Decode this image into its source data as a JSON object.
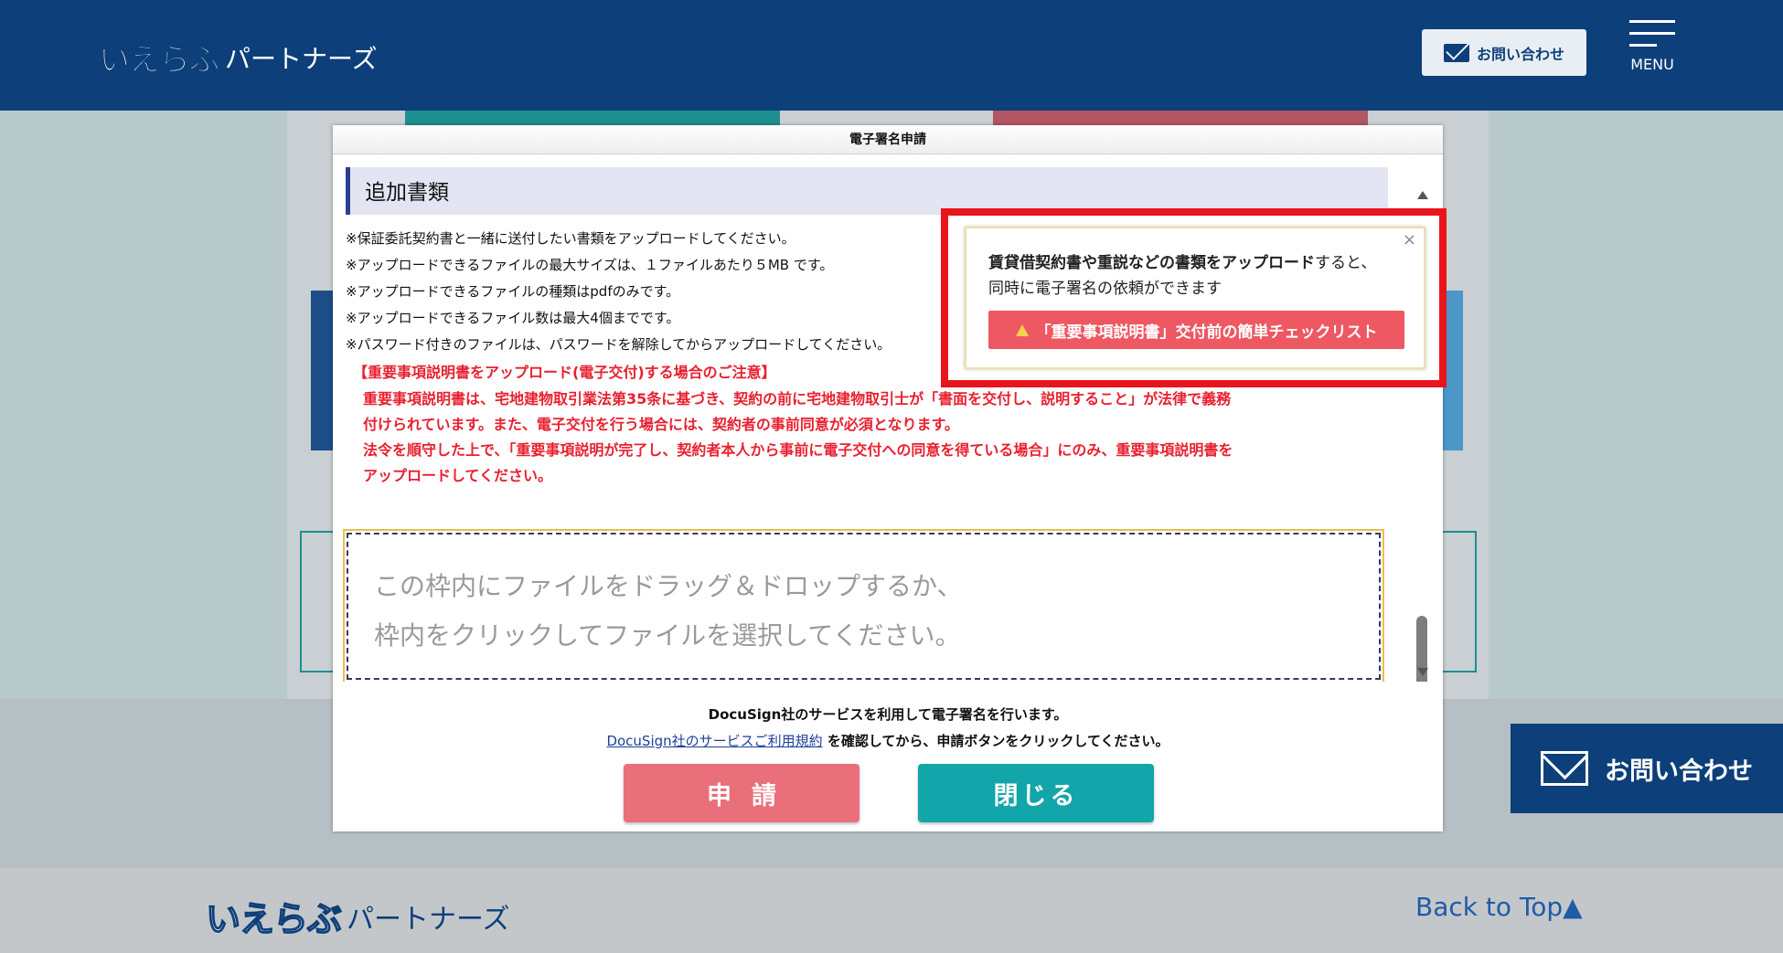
{
  "header": {
    "logo_mark": "いえらぶ",
    "logo_text": "パートナーズ",
    "contact_label": "お問い合わせ",
    "menu_label": "MENU"
  },
  "modal": {
    "title": "電子署名申請",
    "section_title": "追加書類",
    "notes": [
      "※保証委託契約書と一緒に送付したい書類をアップロードしてください。",
      "※アップロードできるファイルの最大サイズは、１ファイルあたり５MB です。",
      "※アップロードできるファイルの種類はpdfのみです。",
      "※アップロードできるファイル数は最大4個までです。",
      "※パスワード付きのファイルは、パスワードを解除してからアップロードしてください。"
    ],
    "warning_title": "【重要事項説明書をアップロード(電子交付)する場合のご注意】",
    "warning_lines": [
      "重要事項説明書は、宅地建物取引業法第35条に基づき、契約の前に宅地建物取引士が「書面を交付し、説明すること」が法律で義務",
      "付けられています。また、電子交付を行う場合には、契約者の事前同意が必須となります。",
      "法令を順守した上で、「重要事項説明が完了し、契約者本人から事前に電子交付への同意を得ている場合」にのみ、重要事項説明書を",
      "アップロードしてください。"
    ],
    "dropzone_line1": "この枠内にファイルをドラッグ＆ドロップするか、",
    "dropzone_line2": "枠内をクリックしてファイルを選択してください。",
    "footer_line1": "DocuSign社のサービスを利用して電子署名を行います。",
    "footer_link": "DocuSign社のサービスご利用規約",
    "footer_line2_rest": " を確認してから、申請ボタンをクリックしてください。",
    "apply_label": "申請",
    "close_label": "閉じる"
  },
  "tooltip": {
    "bold_text": "賃貸借契約書や重説などの書類をアップロード",
    "text_rest": "すると、",
    "text_line2": "同時に電子署名の依頼ができます",
    "close_glyph": "×",
    "button_label": "「重要事項説明書」交付前の簡単チェックリスト"
  },
  "float_contact_label": "お問い合わせ",
  "footer": {
    "logo_mark": "いえらぶ",
    "logo_text": "パートナーズ",
    "back_to_top": "Back to Top▲"
  },
  "colors": {
    "header_bg": "#0d3f7a",
    "warning_red": "#e8202f",
    "apply_btn": "#e9707b",
    "close_btn": "#12a5a9",
    "highlight_frame": "#e8151c"
  }
}
